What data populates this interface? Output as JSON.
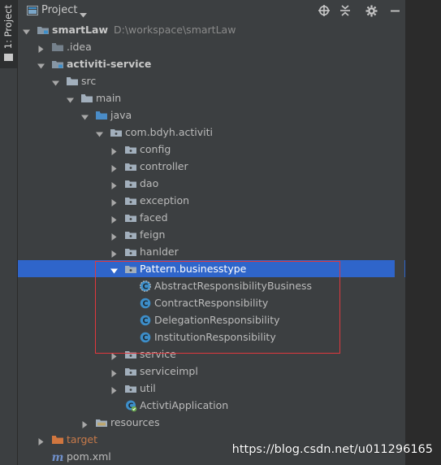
{
  "side_tab": {
    "label": "1: Project"
  },
  "header": {
    "title": "Project"
  },
  "tree": [
    {
      "label": "smartLaw",
      "path": "D:\\workspace\\smartLaw",
      "type": "module",
      "expanded": true,
      "bold": true
    },
    {
      "label": ".idea",
      "type": "folder-gray",
      "expanded": false
    },
    {
      "label": "activiti-service",
      "type": "module",
      "expanded": true,
      "bold": true
    },
    {
      "label": "src",
      "type": "folder",
      "expanded": true
    },
    {
      "label": "main",
      "type": "folder",
      "expanded": true
    },
    {
      "label": "java",
      "type": "folder-source",
      "expanded": true
    },
    {
      "label": "com.bdyh.activiti",
      "type": "package",
      "expanded": true
    },
    {
      "label": "config",
      "type": "package",
      "expanded": false
    },
    {
      "label": "controller",
      "type": "package",
      "expanded": false
    },
    {
      "label": "dao",
      "type": "package",
      "expanded": false
    },
    {
      "label": "exception",
      "type": "package",
      "expanded": false
    },
    {
      "label": "faced",
      "type": "package",
      "expanded": false
    },
    {
      "label": "feign",
      "type": "package",
      "expanded": false
    },
    {
      "label": "hanlder",
      "type": "package",
      "expanded": false
    },
    {
      "label": "Pattern.businesstype",
      "type": "package",
      "expanded": true,
      "selected": true
    },
    {
      "label": "AbstractResponsibilityBusiness",
      "type": "class-abstract"
    },
    {
      "label": "ContractResponsibility",
      "type": "class"
    },
    {
      "label": "DelegationResponsibility",
      "type": "class"
    },
    {
      "label": "InstitutionResponsibility",
      "type": "class"
    },
    {
      "label": "service",
      "type": "package",
      "expanded": false
    },
    {
      "label": "serviceimpl",
      "type": "package",
      "expanded": false
    },
    {
      "label": "util",
      "type": "package",
      "expanded": false
    },
    {
      "label": "ActivtiApplication",
      "type": "class-app"
    },
    {
      "label": "resources",
      "type": "folder-resources",
      "expanded": false
    },
    {
      "label": "target",
      "type": "folder-excluded",
      "expanded": false,
      "excluded": true
    },
    {
      "label": "pom.xml",
      "type": "maven"
    }
  ],
  "watermark": "https://blog.csdn.net/u011296165",
  "colors": {
    "background": "#3c3f41",
    "selection": "#2f65ca",
    "highlight_box": "#e0383d",
    "class_icon": "#3d8ec9",
    "folder_icon": "#a9b7c6",
    "excluded": "#c77a4a"
  }
}
